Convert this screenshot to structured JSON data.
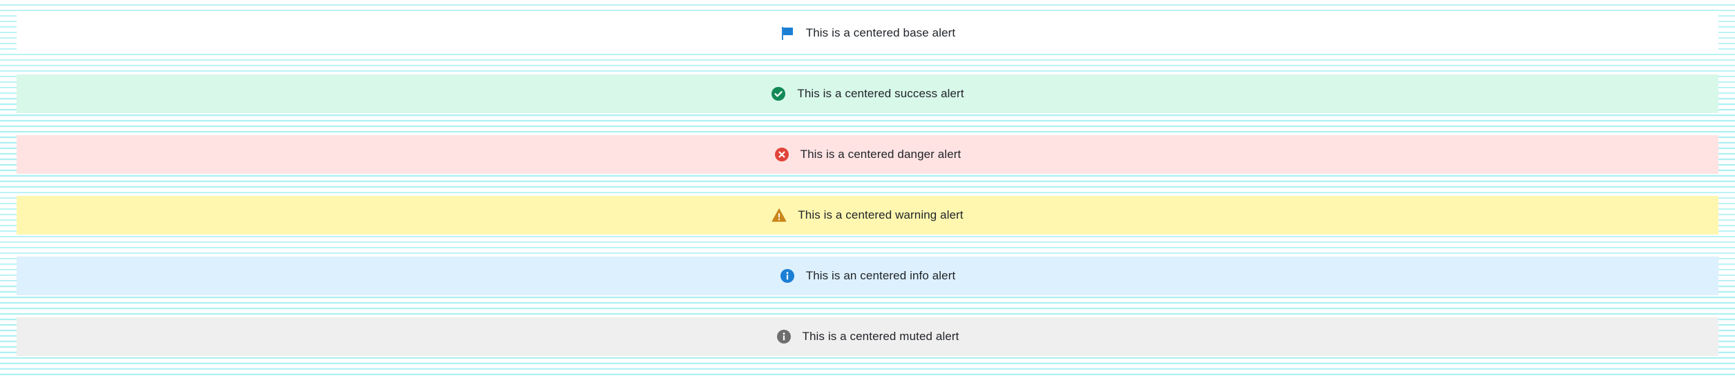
{
  "alerts": [
    {
      "id": "base",
      "icon": "flag-icon",
      "text": "This is a centered base alert",
      "bg": "#ffffff",
      "icon_color": "#1a7fd4"
    },
    {
      "id": "success",
      "icon": "check-circle-icon",
      "text": "This is a centered success alert",
      "bg": "#d8f8ea",
      "icon_color": "#128a57"
    },
    {
      "id": "danger",
      "icon": "close-circle-icon",
      "text": "This is a centered danger alert",
      "bg": "#ffe3e3",
      "icon_color": "#e0453a"
    },
    {
      "id": "warning",
      "icon": "warning-triangle-icon",
      "text": "This is a centered warning alert",
      "bg": "#fff7b0",
      "icon_color": "#c9861a"
    },
    {
      "id": "info",
      "icon": "info-circle-icon",
      "text": "This is an centered info alert",
      "bg": "#ddf0fd",
      "icon_color": "#1a7fd4"
    },
    {
      "id": "muted",
      "icon": "info-circle-muted-icon",
      "text": "This is a centered muted alert",
      "bg": "#f0efef",
      "icon_color": "#6e6e6e"
    }
  ]
}
